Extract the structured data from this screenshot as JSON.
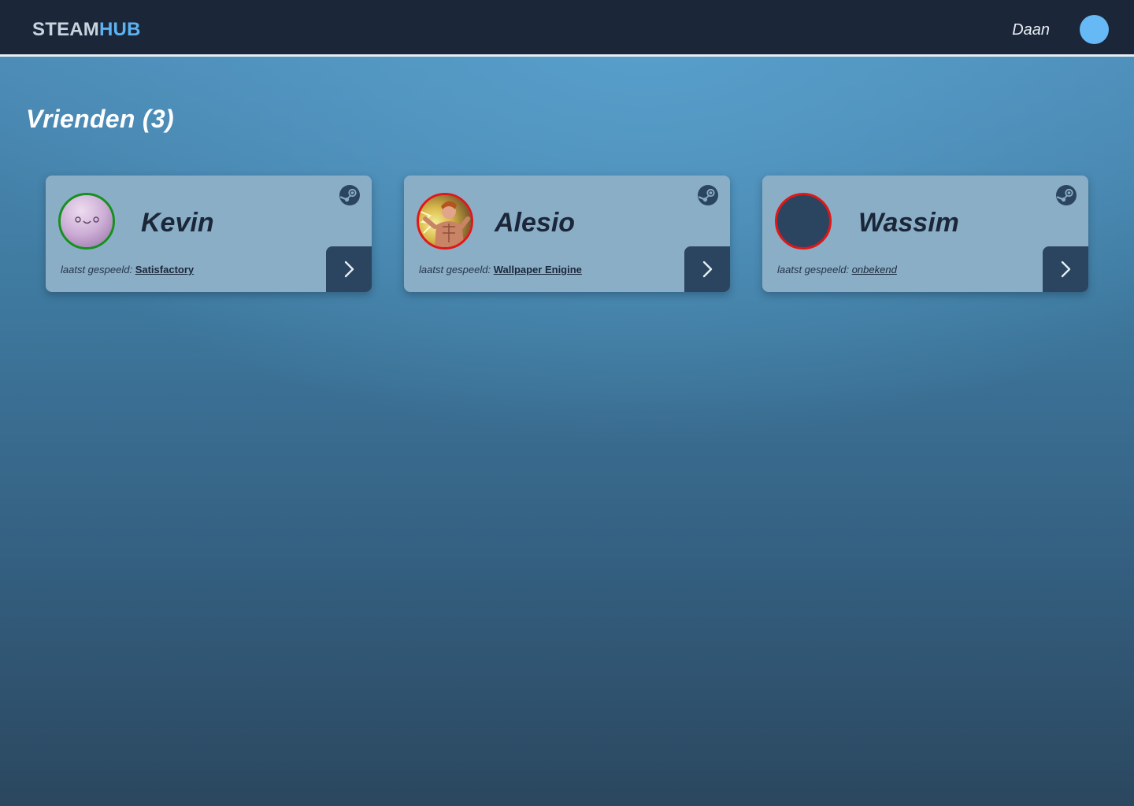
{
  "header": {
    "logo_part1": "STEAM",
    "logo_part2": "HUB",
    "username": "Daan"
  },
  "page": {
    "title": "Vrienden (3)"
  },
  "friends": [
    {
      "name": "Kevin",
      "status": "online",
      "last_played_label": "laatst gespeeld:",
      "last_played": "Satisfactory"
    },
    {
      "name": "Alesio",
      "status": "offline",
      "last_played_label": "laatst gespeeld:",
      "last_played": "Wallpaper Enigine"
    },
    {
      "name": "Wassim",
      "status": "offline",
      "last_played_label": "laatst gespeeld:",
      "last_played": "onbekend"
    }
  ],
  "icons": {
    "steam": "steam-icon",
    "open": "chevron-right-icon"
  },
  "colors": {
    "navbar": "#1b2739",
    "accent": "#5db3f2",
    "card": "#8aaec6",
    "card_button": "#2b4560",
    "online": "#16901f",
    "offline": "#e11717"
  }
}
